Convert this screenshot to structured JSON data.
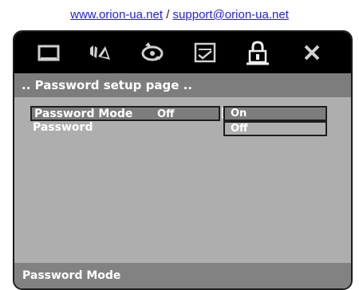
{
  "weblinks": {
    "site": "www.orion-ua.net",
    "separator": " / ",
    "email": "support@orion-ua.net"
  },
  "iconbar": {
    "icons": [
      "monitor-icon",
      "audio-speaker-icon",
      "disc-icon",
      "preference-checklist-icon",
      "padlock-icon",
      "close-icon"
    ],
    "selected": "padlock-icon"
  },
  "header": {
    "title": ".. Password setup page .."
  },
  "menu": {
    "items": [
      {
        "label": "Password Mode",
        "value": "Off",
        "selected": true
      },
      {
        "label": "Password",
        "value": ""
      }
    ]
  },
  "options": [
    {
      "label": "On",
      "highlighted": true
    },
    {
      "label": "Off",
      "highlighted": false
    }
  ],
  "footer": {
    "hint": "Password Mode"
  },
  "colors": {
    "panel": "#aeaeae",
    "iconbar": "#000000",
    "highlight": "#7d7d7d",
    "text": "#ffffff",
    "link": "#1f1fe6"
  }
}
